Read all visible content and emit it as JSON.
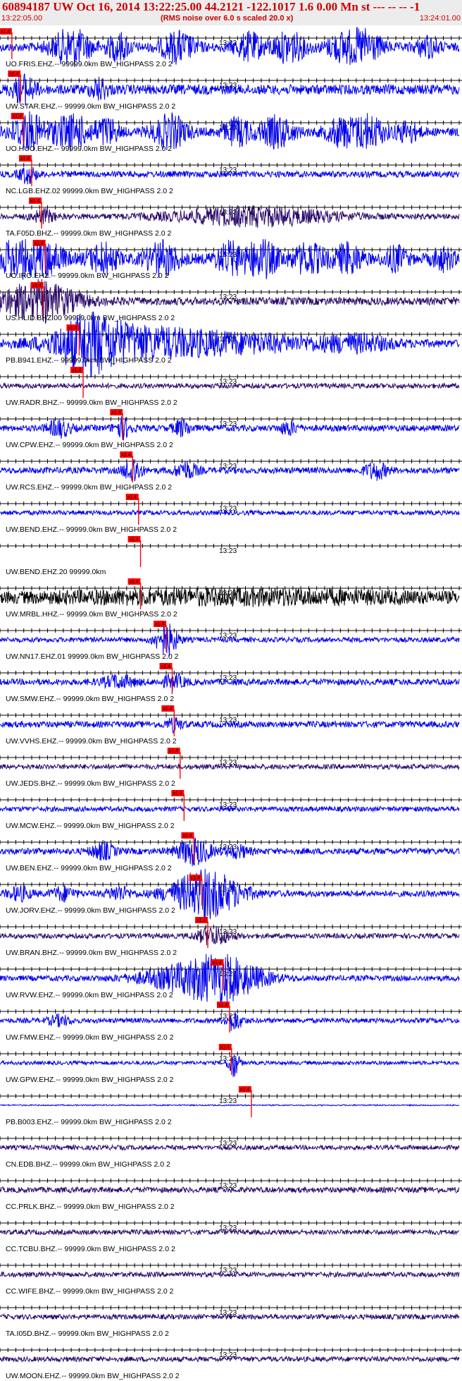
{
  "header": {
    "title": "60894187 UW Oct 16, 2014 13:22:25.00   44.2121 -122.1017  1.6 0.00 Mn st --- -- --   -1",
    "time_start": "13:22:05.00",
    "time_end": "13:24:01.00",
    "subtitle": "(RMS noise over 6.0 s scaled 20.0 x)"
  },
  "chart_data": {
    "type": "line",
    "title": "60894187 UW Oct 16, 2014 13:22:25.00   44.2121 -122.1017  1.6 0.00 Mn st --- -- --   -1",
    "x_range_seconds": [
      0,
      116
    ],
    "mid_tick_label": "13:23",
    "pick_marker_label": "x1.4",
    "colors": {
      "title": "#cc0000",
      "pick": "#ff0000",
      "trace_blue": "#0000ee",
      "trace_purple": "#2a0a6a",
      "trace_black": "#000000"
    },
    "series": [
      {
        "name": "UO.FRIS.EHZ.-- 99999.0km BW_HIGHPASS  2.0  2",
        "pick_s": 3.0,
        "color": "#0000ee",
        "amp": 0.28,
        "bursts": [
          [
            18,
            3.5,
            1.1
          ],
          [
            30,
            2,
            0.8
          ],
          [
            45,
            3,
            0.9
          ],
          [
            63,
            2.5,
            0.8
          ],
          [
            73,
            3,
            0.9
          ],
          [
            86,
            2.5,
            0.7
          ],
          [
            92,
            3,
            1.0
          ],
          [
            108,
            2,
            0.6
          ]
        ]
      },
      {
        "name": "UW.STAR.EHZ.-- 99999.0km BW_HIGHPASS  2.0  2",
        "pick_s": 5.2,
        "color": "#0000ee",
        "amp": 0.32,
        "bursts": [
          [
            6,
            2,
            0.8
          ],
          [
            25,
            1.5,
            0.6
          ]
        ]
      },
      {
        "name": "UO.HUO.EHZ.-- 99999.0km BW_HIGHPASS  2.0  2",
        "pick_s": 6.0,
        "color": "#0000ee",
        "amp": 0.28,
        "bursts": [
          [
            7,
            3,
            1.1
          ],
          [
            18,
            3.5,
            1.0
          ],
          [
            27,
            2,
            0.8
          ],
          [
            43,
            3,
            1.0
          ],
          [
            60,
            2.5,
            0.8
          ],
          [
            70,
            3,
            0.9
          ],
          [
            86,
            2.5,
            0.8
          ],
          [
            93,
            3,
            1.0
          ],
          [
            103,
            2,
            0.6
          ]
        ]
      },
      {
        "name": "NC.LGB.EHZ.02 99999.0km BW_HIGHPASS  2.0  2",
        "pick_s": 8.0,
        "color": "#0000ee",
        "amp": 0.2,
        "bursts": [
          [
            7,
            1.5,
            0.5
          ]
        ]
      },
      {
        "name": "TA.F05D.BHZ.-- 99999.0km BW_HIGHPASS  2.0  2",
        "pick_s": 10.5,
        "color": "#2a0a6a",
        "amp": 0.18,
        "bursts": [
          [
            11,
            2,
            0.4
          ],
          [
            64,
            14,
            0.55
          ]
        ]
      },
      {
        "name": "UO.IRO.EHZ.-- 99999.0km BW_HIGHPASS  2.0  2",
        "pick_s": 11.5,
        "color": "#0000ee",
        "amp": 0.32,
        "bursts": [
          [
            4,
            3,
            1.1
          ],
          [
            12,
            3,
            1.0
          ],
          [
            26,
            2.5,
            0.9
          ],
          [
            41,
            3,
            1.0
          ],
          [
            58,
            2.5,
            0.9
          ],
          [
            66,
            3,
            1.1
          ],
          [
            78,
            3,
            0.9
          ],
          [
            88,
            2.5,
            0.9
          ],
          [
            100,
            2,
            0.7
          ],
          [
            112,
            2,
            0.6
          ]
        ]
      },
      {
        "name": "US.HLID.BHZ.00 99999.0km BW_HIGHPASS  2.0  2",
        "pick_s": 11.0,
        "color": "#2a0a6a",
        "amp": 0.25,
        "bursts": [
          [
            11,
            5,
            0.7
          ],
          [
            6,
            10,
            0.55
          ]
        ]
      },
      {
        "name": "PB.B941.EHZ.-- 99999.0km BW_HIGHPASS  2.0  2",
        "pick_s": 20.0,
        "color": "#0000ee",
        "amp": 0.25,
        "bursts": [
          [
            22,
            5,
            1.2
          ],
          [
            30,
            12,
            0.8
          ],
          [
            55,
            18,
            0.55
          ],
          [
            90,
            6,
            0.4
          ]
        ]
      },
      {
        "name": "UW.RADR.BHZ.-- 99999.0km BW_HIGHPASS  2.0  2",
        "pick_s": 21.0,
        "color": "#2a0a6a",
        "amp": 0.16,
        "bursts": []
      },
      {
        "name": "UW.CPW.EHZ.-- 99999.0km BW_HIGHPASS  2.0  2",
        "pick_s": 31.0,
        "color": "#0000ee",
        "amp": 0.2,
        "bursts": [
          [
            15,
            2,
            0.5
          ],
          [
            31,
            1.5,
            0.6
          ],
          [
            46,
            1.5,
            0.5
          ],
          [
            73,
            1.5,
            0.4
          ]
        ]
      },
      {
        "name": "UW.RCS.EHZ.-- 99999.0km BW_HIGHPASS  2.0  2",
        "pick_s": 33.5,
        "color": "#0000ee",
        "amp": 0.2,
        "bursts": [
          [
            33.5,
            1.5,
            0.8
          ],
          [
            47,
            2,
            0.5
          ],
          [
            95,
            2,
            0.5
          ]
        ]
      },
      {
        "name": "UW.BEND.EHZ.-- 99999.0km BW_HIGHPASS  2.0  2",
        "pick_s": 35.0,
        "color": "#0000ee",
        "amp": 0.15,
        "bursts": []
      },
      {
        "name": "UW.BEND.EHZ.20 99999.0km",
        "pick_s": 35.5,
        "color": "#0000ee",
        "amp": 0.0,
        "bursts": []
      },
      {
        "name": "UW.MRBL.HHZ.-- 99999.0km BW_HIGHPASS  2.0  2",
        "pick_s": 35.5,
        "color": "#000000",
        "amp": 0.28,
        "bursts": [
          [
            60,
            40,
            0.35
          ]
        ]
      },
      {
        "name": "UW.NN17.EHZ.01 99999.0km BW_HIGHPASS  2.0  2",
        "pick_s": 42.0,
        "color": "#0000ee",
        "amp": 0.16,
        "bursts": [
          [
            42,
            2,
            1.0
          ]
        ]
      },
      {
        "name": "UW.SMW.EHZ.-- 99999.0km BW_HIGHPASS  2.0  2",
        "pick_s": 43.5,
        "color": "#0000ee",
        "amp": 0.2,
        "bursts": [
          [
            30,
            3,
            0.35
          ],
          [
            44,
            2,
            0.4
          ]
        ]
      },
      {
        "name": "UW.VVHS.EHZ.-- 99999.0km BW_HIGHPASS  2.0  2",
        "pick_s": 44.0,
        "color": "#0000ee",
        "amp": 0.2,
        "bursts": [
          [
            44,
            1.5,
            0.35
          ]
        ]
      },
      {
        "name": "UW.JEDS.BHZ.-- 99999.0km BW_HIGHPASS  2.0  2",
        "pick_s": 45.5,
        "color": "#2a0a6a",
        "amp": 0.16,
        "bursts": []
      },
      {
        "name": "UW.MCW.EHZ.-- 99999.0km BW_HIGHPASS  2.0  2",
        "pick_s": 46.5,
        "color": "#0000ee",
        "amp": 0.16,
        "bursts": []
      },
      {
        "name": "UW.BEN.EHZ.-- 99999.0km BW_HIGHPASS  2.0  2",
        "pick_s": 49.0,
        "color": "#0000ee",
        "amp": 0.2,
        "bursts": [
          [
            26,
            2,
            0.5
          ],
          [
            49,
            3,
            0.8
          ],
          [
            60,
            2,
            0.35
          ]
        ]
      },
      {
        "name": "UW.JORV.EHZ.-- 99999.0km BW_HIGHPASS  2.0  2",
        "pick_s": 51.0,
        "color": "#0000ee",
        "amp": 0.2,
        "bursts": [
          [
            52,
            6,
            1.5
          ],
          [
            5,
            2,
            0.4
          ],
          [
            16,
            2,
            0.4
          ],
          [
            30,
            2,
            0.4
          ]
        ]
      },
      {
        "name": "UW.BRAN.BHZ.-- 99999.0km BW_HIGHPASS  2.0  2",
        "pick_s": 52.5,
        "color": "#2a0a6a",
        "amp": 0.16,
        "bursts": [
          [
            54,
            3,
            0.55
          ]
        ]
      },
      {
        "name": "UW.RVW.EHZ.-- 99999.0km BW_HIGHPASS  2.0  2",
        "pick_s": 56.5,
        "color": "#0000ee",
        "amp": 0.18,
        "bursts": [
          [
            56,
            7,
            1.3
          ],
          [
            45,
            8,
            0.5
          ]
        ]
      },
      {
        "name": "UW.FMW.EHZ.-- 99999.0km BW_HIGHPASS  2.0  2",
        "pick_s": 58.0,
        "color": "#0000ee",
        "amp": 0.16,
        "bursts": [
          [
            59,
            1.5,
            0.6
          ],
          [
            15,
            2,
            0.3
          ]
        ]
      },
      {
        "name": "UW.GPW.EHZ.-- 99999.0km BW_HIGHPASS  2.0  2",
        "pick_s": 58.5,
        "color": "#0000ee",
        "amp": 0.12,
        "bursts": [
          [
            59,
            1,
            0.9
          ]
        ]
      },
      {
        "name": "PB.B003.EHZ.-- 99999.0km BW_HIGHPASS  2.0  2",
        "pick_s": 63.5,
        "color": "#0000ee",
        "amp": 0.04,
        "bursts": []
      },
      {
        "name": "CN.EDB.BHZ.-- 99999.0km BW_HIGHPASS  2.0  2",
        "pick_s": null,
        "color": "#2a0a6a",
        "amp": 0.15,
        "bursts": []
      },
      {
        "name": "CC.PRLK.BHZ.-- 99999.0km BW_HIGHPASS  2.0  2",
        "pick_s": null,
        "color": "#2a0a6a",
        "amp": 0.18,
        "bursts": []
      },
      {
        "name": "CC.TCBU.BHZ.-- 99999.0km BW_HIGHPASS  2.0  2",
        "pick_s": null,
        "color": "#2a0a6a",
        "amp": 0.16,
        "bursts": []
      },
      {
        "name": "CC.WIFE.BHZ.-- 99999.0km BW_HIGHPASS  2.0  2",
        "pick_s": null,
        "color": "#2a0a6a",
        "amp": 0.16,
        "bursts": []
      },
      {
        "name": "TA.I05D.BHZ.-- 99999.0km BW_HIGHPASS  2.0  2",
        "pick_s": null,
        "color": "#2a0a6a",
        "amp": 0.16,
        "bursts": []
      },
      {
        "name": "UW.MOON.EHZ.-- 99999.0km BW_HIGHPASS  2.0  2",
        "pick_s": null,
        "color": "#2a0a6a",
        "amp": 0.16,
        "bursts": []
      }
    ]
  }
}
